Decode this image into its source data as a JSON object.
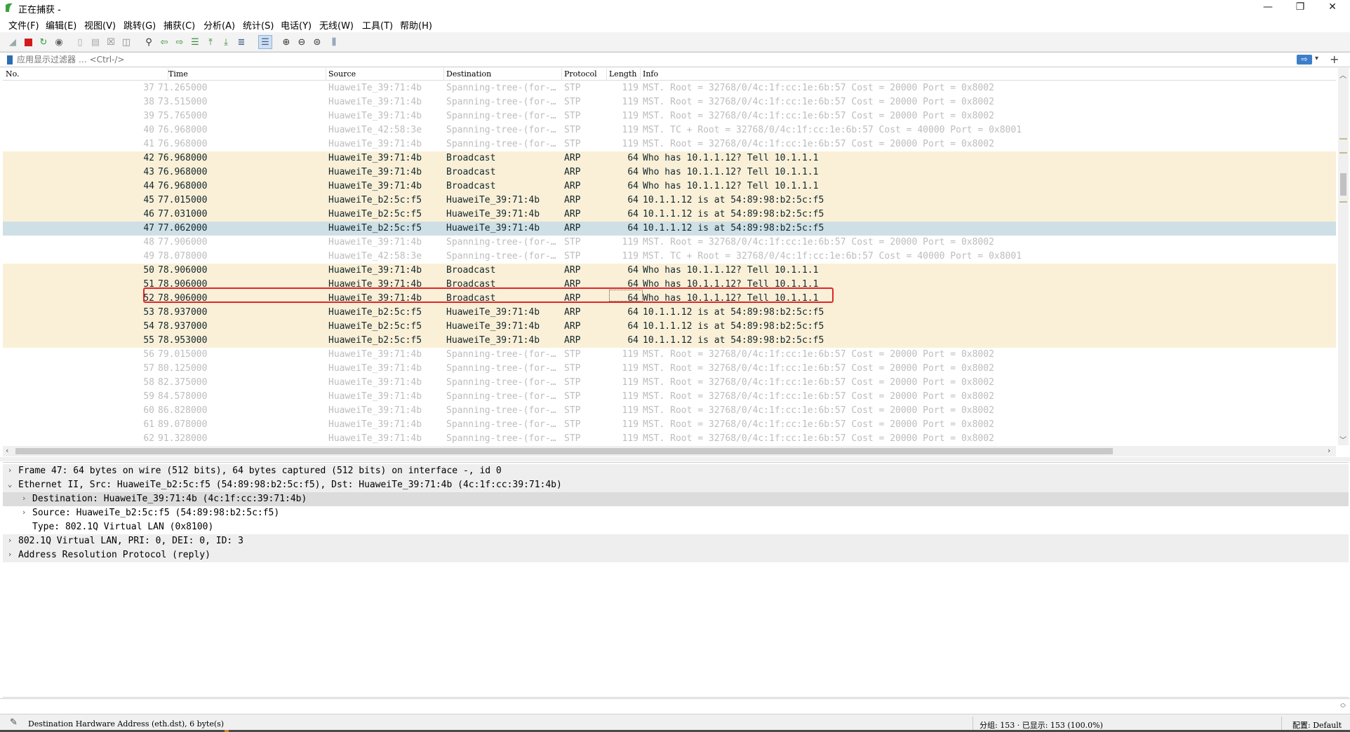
{
  "window": {
    "title": "正在捕获 -",
    "minimize": "—",
    "maximize": "❐",
    "close": "✕"
  },
  "menu": [
    "文件(F)",
    "编辑(E)",
    "视图(V)",
    "跳转(G)",
    "捕获(C)",
    "分析(A)",
    "统计(S)",
    "电话(Y)",
    "无线(W)",
    "工具(T)",
    "帮助(H)"
  ],
  "toolbar_icons": [
    "shark-fin-icon",
    "stop-capture-icon",
    "restart-capture-icon",
    "capture-options-icon",
    "open-file-icon",
    "save-file-icon",
    "close-file-icon",
    "reload-file-icon",
    "find-packet-icon",
    "go-back-icon",
    "go-forward-icon",
    "go-to-packet-icon",
    "go-first-icon",
    "go-last-icon",
    "auto-scroll-icon",
    "colorize-icon",
    "zoom-in-icon",
    "zoom-out-icon",
    "zoom-normal-icon",
    "resize-columns-icon"
  ],
  "filter": {
    "placeholder": "应用显示过滤器 … <Ctrl-/>",
    "apply_label": "⇨",
    "dropdown": "▾",
    "add": "+"
  },
  "packet_list": {
    "columns": [
      "No.",
      "Time",
      "Source",
      "Destination",
      "Protocol",
      "Length",
      "Info"
    ],
    "rows": [
      {
        "no": "37",
        "time": "71.265000",
        "src": "HuaweiTe_39:71:4b",
        "dst": "Spanning-tree-(for-…",
        "proto": "STP",
        "len": "119",
        "info": "MST. Root = 32768/0/4c:1f:cc:1e:6b:57  Cost = 20000  Port = 0x8002",
        "kind": "stp"
      },
      {
        "no": "38",
        "time": "73.515000",
        "src": "HuaweiTe_39:71:4b",
        "dst": "Spanning-tree-(for-…",
        "proto": "STP",
        "len": "119",
        "info": "MST. Root = 32768/0/4c:1f:cc:1e:6b:57  Cost = 20000  Port = 0x8002",
        "kind": "stp"
      },
      {
        "no": "39",
        "time": "75.765000",
        "src": "HuaweiTe_39:71:4b",
        "dst": "Spanning-tree-(for-…",
        "proto": "STP",
        "len": "119",
        "info": "MST. Root = 32768/0/4c:1f:cc:1e:6b:57  Cost = 20000  Port = 0x8002",
        "kind": "stp"
      },
      {
        "no": "40",
        "time": "76.968000",
        "src": "HuaweiTe_42:58:3e",
        "dst": "Spanning-tree-(for-…",
        "proto": "STP",
        "len": "119",
        "info": "MST. TC + Root = 32768/0/4c:1f:cc:1e:6b:57  Cost = 40000  Port = 0x8001",
        "kind": "stp"
      },
      {
        "no": "41",
        "time": "76.968000",
        "src": "HuaweiTe_39:71:4b",
        "dst": "Spanning-tree-(for-…",
        "proto": "STP",
        "len": "119",
        "info": "MST. Root = 32768/0/4c:1f:cc:1e:6b:57  Cost = 20000  Port = 0x8002",
        "kind": "stp"
      },
      {
        "no": "42",
        "time": "76.968000",
        "src": "HuaweiTe_39:71:4b",
        "dst": "Broadcast",
        "proto": "ARP",
        "len": "64",
        "info": "Who has 10.1.1.12? Tell 10.1.1.1",
        "kind": "arp"
      },
      {
        "no": "43",
        "time": "76.968000",
        "src": "HuaweiTe_39:71:4b",
        "dst": "Broadcast",
        "proto": "ARP",
        "len": "64",
        "info": "Who has 10.1.1.12? Tell 10.1.1.1",
        "kind": "arp"
      },
      {
        "no": "44",
        "time": "76.968000",
        "src": "HuaweiTe_39:71:4b",
        "dst": "Broadcast",
        "proto": "ARP",
        "len": "64",
        "info": "Who has 10.1.1.12? Tell 10.1.1.1",
        "kind": "arp"
      },
      {
        "no": "45",
        "time": "77.015000",
        "src": "HuaweiTe_b2:5c:f5",
        "dst": "HuaweiTe_39:71:4b",
        "proto": "ARP",
        "len": "64",
        "info": "10.1.1.12 is at 54:89:98:b2:5c:f5",
        "kind": "arp"
      },
      {
        "no": "46",
        "time": "77.031000",
        "src": "HuaweiTe_b2:5c:f5",
        "dst": "HuaweiTe_39:71:4b",
        "proto": "ARP",
        "len": "64",
        "info": "10.1.1.12 is at 54:89:98:b2:5c:f5",
        "kind": "arp"
      },
      {
        "no": "47",
        "time": "77.062000",
        "src": "HuaweiTe_b2:5c:f5",
        "dst": "HuaweiTe_39:71:4b",
        "proto": "ARP",
        "len": "64",
        "info": "10.1.1.12 is at 54:89:98:b2:5c:f5",
        "kind": "sel"
      },
      {
        "no": "48",
        "time": "77.906000",
        "src": "HuaweiTe_39:71:4b",
        "dst": "Spanning-tree-(for-…",
        "proto": "STP",
        "len": "119",
        "info": "MST. Root = 32768/0/4c:1f:cc:1e:6b:57  Cost = 20000  Port = 0x8002",
        "kind": "stp"
      },
      {
        "no": "49",
        "time": "78.078000",
        "src": "HuaweiTe_42:58:3e",
        "dst": "Spanning-tree-(for-…",
        "proto": "STP",
        "len": "119",
        "info": "MST. TC + Root = 32768/0/4c:1f:cc:1e:6b:57  Cost = 40000  Port = 0x8001",
        "kind": "stp"
      },
      {
        "no": "50",
        "time": "78.906000",
        "src": "HuaweiTe_39:71:4b",
        "dst": "Broadcast",
        "proto": "ARP",
        "len": "64",
        "info": "Who has 10.1.1.12? Tell 10.1.1.1",
        "kind": "arp"
      },
      {
        "no": "51",
        "time": "78.906000",
        "src": "HuaweiTe_39:71:4b",
        "dst": "Broadcast",
        "proto": "ARP",
        "len": "64",
        "info": "Who has 10.1.1.12? Tell 10.1.1.1",
        "kind": "arp"
      },
      {
        "no": "52",
        "time": "78.906000",
        "src": "HuaweiTe_39:71:4b",
        "dst": "Broadcast",
        "proto": "ARP",
        "len": "64",
        "info": "Who has 10.1.1.12? Tell 10.1.1.1",
        "kind": "arp"
      },
      {
        "no": "53",
        "time": "78.937000",
        "src": "HuaweiTe_b2:5c:f5",
        "dst": "HuaweiTe_39:71:4b",
        "proto": "ARP",
        "len": "64",
        "info": "10.1.1.12 is at 54:89:98:b2:5c:f5",
        "kind": "arp"
      },
      {
        "no": "54",
        "time": "78.937000",
        "src": "HuaweiTe_b2:5c:f5",
        "dst": "HuaweiTe_39:71:4b",
        "proto": "ARP",
        "len": "64",
        "info": "10.1.1.12 is at 54:89:98:b2:5c:f5",
        "kind": "arp"
      },
      {
        "no": "55",
        "time": "78.953000",
        "src": "HuaweiTe_b2:5c:f5",
        "dst": "HuaweiTe_39:71:4b",
        "proto": "ARP",
        "len": "64",
        "info": "10.1.1.12 is at 54:89:98:b2:5c:f5",
        "kind": "arp"
      },
      {
        "no": "56",
        "time": "79.015000",
        "src": "HuaweiTe_39:71:4b",
        "dst": "Spanning-tree-(for-…",
        "proto": "STP",
        "len": "119",
        "info": "MST. Root = 32768/0/4c:1f:cc:1e:6b:57  Cost = 20000  Port = 0x8002",
        "kind": "stp"
      },
      {
        "no": "57",
        "time": "80.125000",
        "src": "HuaweiTe_39:71:4b",
        "dst": "Spanning-tree-(for-…",
        "proto": "STP",
        "len": "119",
        "info": "MST. Root = 32768/0/4c:1f:cc:1e:6b:57  Cost = 20000  Port = 0x8002",
        "kind": "stp"
      },
      {
        "no": "58",
        "time": "82.375000",
        "src": "HuaweiTe_39:71:4b",
        "dst": "Spanning-tree-(for-…",
        "proto": "STP",
        "len": "119",
        "info": "MST. Root = 32768/0/4c:1f:cc:1e:6b:57  Cost = 20000  Port = 0x8002",
        "kind": "stp"
      },
      {
        "no": "59",
        "time": "84.578000",
        "src": "HuaweiTe_39:71:4b",
        "dst": "Spanning-tree-(for-…",
        "proto": "STP",
        "len": "119",
        "info": "MST. Root = 32768/0/4c:1f:cc:1e:6b:57  Cost = 20000  Port = 0x8002",
        "kind": "stp"
      },
      {
        "no": "60",
        "time": "86.828000",
        "src": "HuaweiTe_39:71:4b",
        "dst": "Spanning-tree-(for-…",
        "proto": "STP",
        "len": "119",
        "info": "MST. Root = 32768/0/4c:1f:cc:1e:6b:57  Cost = 20000  Port = 0x8002",
        "kind": "stp"
      },
      {
        "no": "61",
        "time": "89.078000",
        "src": "HuaweiTe_39:71:4b",
        "dst": "Spanning-tree-(for-…",
        "proto": "STP",
        "len": "119",
        "info": "MST. Root = 32768/0/4c:1f:cc:1e:6b:57  Cost = 20000  Port = 0x8002",
        "kind": "stp"
      },
      {
        "no": "62",
        "time": "91.328000",
        "src": "HuaweiTe_39:71:4b",
        "dst": "Spanning-tree-(for-…",
        "proto": "STP",
        "len": "119",
        "info": "MST. Root = 32768/0/4c:1f:cc:1e:6b:57  Cost = 20000  Port = 0x8002",
        "kind": "stp"
      }
    ]
  },
  "colors": {
    "arp_row": "#faf0d7",
    "selected_row": "#cfdfe6",
    "stp_text": "#bdbdbd",
    "highlight_box": "#e0262a"
  },
  "details": [
    {
      "indent": 0,
      "expander": "›",
      "text": "Frame 47: 64 bytes on wire (512 bits), 64 bytes captured (512 bits) on interface -, id 0",
      "style": "band"
    },
    {
      "indent": 0,
      "expander": "⌄",
      "text": "Ethernet II, Src: HuaweiTe_b2:5c:f5 (54:89:98:b2:5c:f5), Dst: HuaweiTe_39:71:4b (4c:1f:cc:39:71:4b)",
      "style": "band"
    },
    {
      "indent": 1,
      "expander": "›",
      "text": "Destination: HuaweiTe_39:71:4b (4c:1f:cc:39:71:4b)",
      "style": "sel"
    },
    {
      "indent": 1,
      "expander": "›",
      "text": "Source: HuaweiTe_b2:5c:f5 (54:89:98:b2:5c:f5)",
      "style": "plain"
    },
    {
      "indent": 1,
      "expander": "",
      "text": "Type: 802.1Q Virtual LAN (0x8100)",
      "style": "plain"
    },
    {
      "indent": 0,
      "expander": "›",
      "text": "802.1Q Virtual LAN, PRI: 0, DEI: 0, ID: 3",
      "style": "band"
    },
    {
      "indent": 0,
      "expander": "›",
      "text": "Address Resolution Protocol (reply)",
      "style": "band"
    }
  ],
  "status": {
    "field_info": "Destination Hardware Address (eth.dst), 6 byte(s)",
    "packets": "分组: 153 · 已显示: 153 (100.0%)",
    "profile": "配置: Default"
  }
}
